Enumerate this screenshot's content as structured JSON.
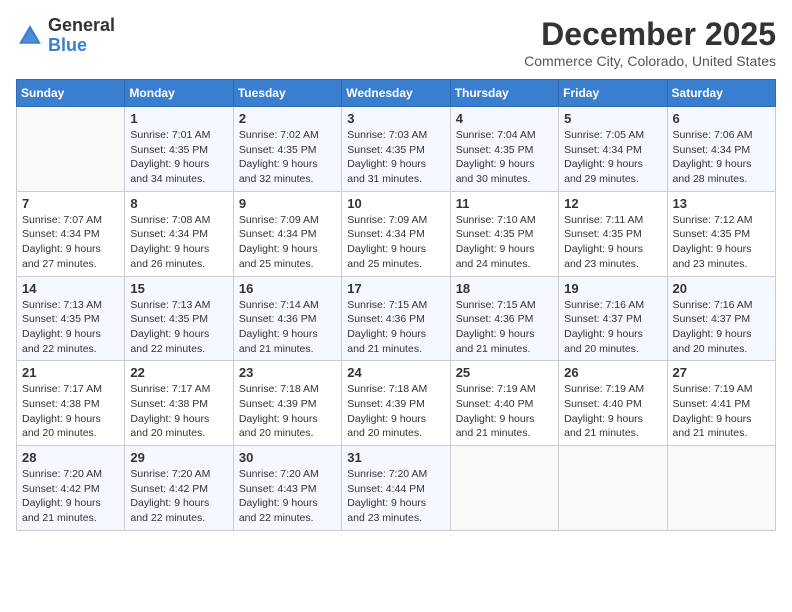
{
  "header": {
    "logo": {
      "line1": "General",
      "line2": "Blue"
    },
    "title": "December 2025",
    "location": "Commerce City, Colorado, United States"
  },
  "days_of_week": [
    "Sunday",
    "Monday",
    "Tuesday",
    "Wednesday",
    "Thursday",
    "Friday",
    "Saturday"
  ],
  "weeks": [
    [
      {
        "day": "",
        "info": ""
      },
      {
        "day": "1",
        "info": "Sunrise: 7:01 AM\nSunset: 4:35 PM\nDaylight: 9 hours\nand 34 minutes."
      },
      {
        "day": "2",
        "info": "Sunrise: 7:02 AM\nSunset: 4:35 PM\nDaylight: 9 hours\nand 32 minutes."
      },
      {
        "day": "3",
        "info": "Sunrise: 7:03 AM\nSunset: 4:35 PM\nDaylight: 9 hours\nand 31 minutes."
      },
      {
        "day": "4",
        "info": "Sunrise: 7:04 AM\nSunset: 4:35 PM\nDaylight: 9 hours\nand 30 minutes."
      },
      {
        "day": "5",
        "info": "Sunrise: 7:05 AM\nSunset: 4:34 PM\nDaylight: 9 hours\nand 29 minutes."
      },
      {
        "day": "6",
        "info": "Sunrise: 7:06 AM\nSunset: 4:34 PM\nDaylight: 9 hours\nand 28 minutes."
      }
    ],
    [
      {
        "day": "7",
        "info": "Sunrise: 7:07 AM\nSunset: 4:34 PM\nDaylight: 9 hours\nand 27 minutes."
      },
      {
        "day": "8",
        "info": "Sunrise: 7:08 AM\nSunset: 4:34 PM\nDaylight: 9 hours\nand 26 minutes."
      },
      {
        "day": "9",
        "info": "Sunrise: 7:09 AM\nSunset: 4:34 PM\nDaylight: 9 hours\nand 25 minutes."
      },
      {
        "day": "10",
        "info": "Sunrise: 7:09 AM\nSunset: 4:34 PM\nDaylight: 9 hours\nand 25 minutes."
      },
      {
        "day": "11",
        "info": "Sunrise: 7:10 AM\nSunset: 4:35 PM\nDaylight: 9 hours\nand 24 minutes."
      },
      {
        "day": "12",
        "info": "Sunrise: 7:11 AM\nSunset: 4:35 PM\nDaylight: 9 hours\nand 23 minutes."
      },
      {
        "day": "13",
        "info": "Sunrise: 7:12 AM\nSunset: 4:35 PM\nDaylight: 9 hours\nand 23 minutes."
      }
    ],
    [
      {
        "day": "14",
        "info": "Sunrise: 7:13 AM\nSunset: 4:35 PM\nDaylight: 9 hours\nand 22 minutes."
      },
      {
        "day": "15",
        "info": "Sunrise: 7:13 AM\nSunset: 4:35 PM\nDaylight: 9 hours\nand 22 minutes."
      },
      {
        "day": "16",
        "info": "Sunrise: 7:14 AM\nSunset: 4:36 PM\nDaylight: 9 hours\nand 21 minutes."
      },
      {
        "day": "17",
        "info": "Sunrise: 7:15 AM\nSunset: 4:36 PM\nDaylight: 9 hours\nand 21 minutes."
      },
      {
        "day": "18",
        "info": "Sunrise: 7:15 AM\nSunset: 4:36 PM\nDaylight: 9 hours\nand 21 minutes."
      },
      {
        "day": "19",
        "info": "Sunrise: 7:16 AM\nSunset: 4:37 PM\nDaylight: 9 hours\nand 20 minutes."
      },
      {
        "day": "20",
        "info": "Sunrise: 7:16 AM\nSunset: 4:37 PM\nDaylight: 9 hours\nand 20 minutes."
      }
    ],
    [
      {
        "day": "21",
        "info": "Sunrise: 7:17 AM\nSunset: 4:38 PM\nDaylight: 9 hours\nand 20 minutes."
      },
      {
        "day": "22",
        "info": "Sunrise: 7:17 AM\nSunset: 4:38 PM\nDaylight: 9 hours\nand 20 minutes."
      },
      {
        "day": "23",
        "info": "Sunrise: 7:18 AM\nSunset: 4:39 PM\nDaylight: 9 hours\nand 20 minutes."
      },
      {
        "day": "24",
        "info": "Sunrise: 7:18 AM\nSunset: 4:39 PM\nDaylight: 9 hours\nand 20 minutes."
      },
      {
        "day": "25",
        "info": "Sunrise: 7:19 AM\nSunset: 4:40 PM\nDaylight: 9 hours\nand 21 minutes."
      },
      {
        "day": "26",
        "info": "Sunrise: 7:19 AM\nSunset: 4:40 PM\nDaylight: 9 hours\nand 21 minutes."
      },
      {
        "day": "27",
        "info": "Sunrise: 7:19 AM\nSunset: 4:41 PM\nDaylight: 9 hours\nand 21 minutes."
      }
    ],
    [
      {
        "day": "28",
        "info": "Sunrise: 7:20 AM\nSunset: 4:42 PM\nDaylight: 9 hours\nand 21 minutes."
      },
      {
        "day": "29",
        "info": "Sunrise: 7:20 AM\nSunset: 4:42 PM\nDaylight: 9 hours\nand 22 minutes."
      },
      {
        "day": "30",
        "info": "Sunrise: 7:20 AM\nSunset: 4:43 PM\nDaylight: 9 hours\nand 22 minutes."
      },
      {
        "day": "31",
        "info": "Sunrise: 7:20 AM\nSunset: 4:44 PM\nDaylight: 9 hours\nand 23 minutes."
      },
      {
        "day": "",
        "info": ""
      },
      {
        "day": "",
        "info": ""
      },
      {
        "day": "",
        "info": ""
      }
    ]
  ]
}
